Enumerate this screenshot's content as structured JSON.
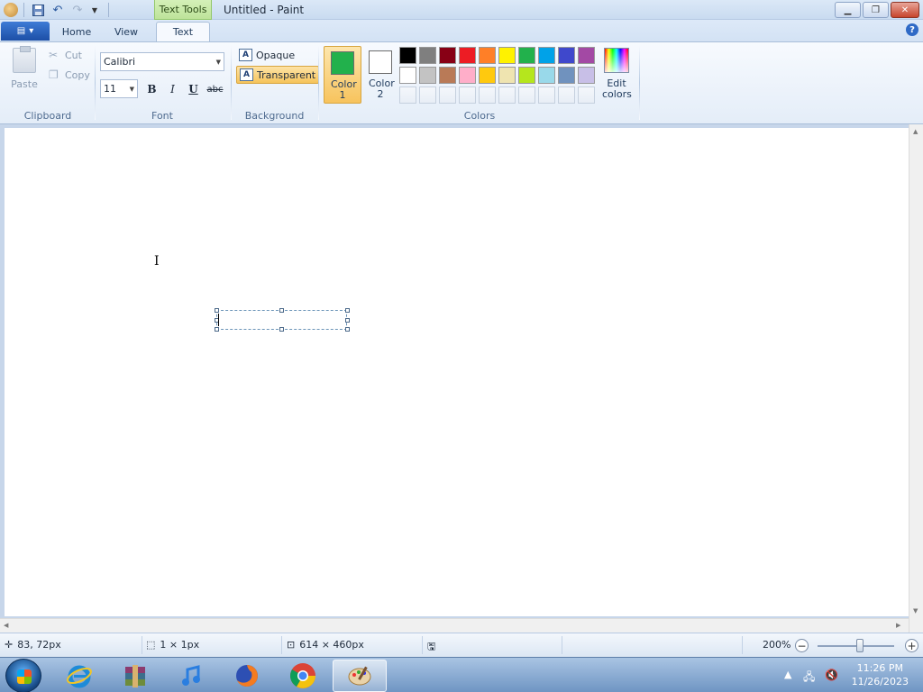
{
  "window": {
    "title": "Untitled - Paint",
    "context_tab": "Text Tools"
  },
  "tabs": {
    "home": "Home",
    "view": "View",
    "text": "Text"
  },
  "clipboard": {
    "paste": "Paste",
    "cut": "Cut",
    "copy": "Copy",
    "group": "Clipboard"
  },
  "font": {
    "family": "Calibri",
    "size": "11",
    "bold": "B",
    "italic": "I",
    "underline": "U",
    "strike": "abc",
    "group": "Font"
  },
  "background": {
    "opaque": "Opaque",
    "transparent": "Transparent",
    "group": "Background",
    "selected": "transparent"
  },
  "colors": {
    "color1_label": "Color 1",
    "color2_label": "Color 2",
    "color1": "#22b14c",
    "color2": "#ffffff",
    "edit": "Edit colors",
    "group": "Colors",
    "palette_row1": [
      "#000000",
      "#7f7f7f",
      "#880015",
      "#ed1c24",
      "#ff7f27",
      "#fff200",
      "#22b14c",
      "#00a2e8",
      "#3f48cc",
      "#a349a4"
    ],
    "palette_row2": [
      "#ffffff",
      "#c3c3c3",
      "#b97a57",
      "#ffaec9",
      "#ffc90e",
      "#efe4b0",
      "#b5e61d",
      "#99d9ea",
      "#7092be",
      "#c8bfe7"
    ]
  },
  "status": {
    "cursor_pos": "83, 72px",
    "selection_size": "1 × 1px",
    "image_size": "614 × 460px",
    "zoom": "200%",
    "zoom_fraction": 0.55
  },
  "taskbar": {
    "time": "11:26 PM",
    "date": "11/26/2023",
    "apps": [
      "internet-explorer",
      "winrar",
      "itunes",
      "firefox",
      "chrome",
      "paint"
    ]
  }
}
